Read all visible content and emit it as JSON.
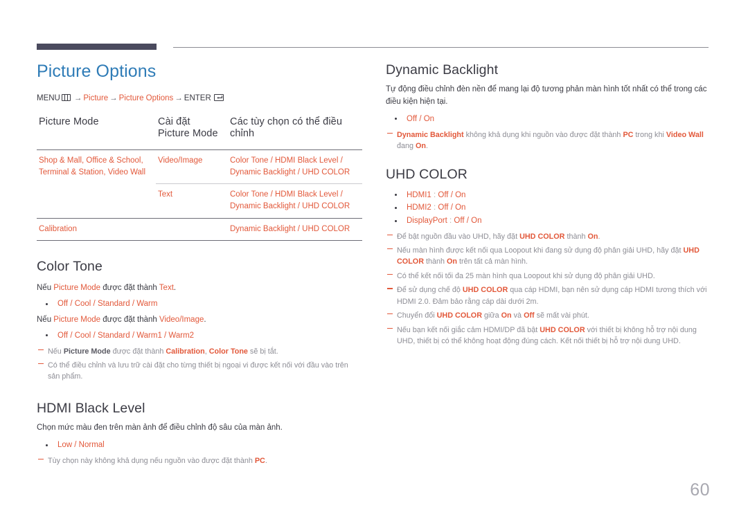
{
  "page": {
    "number": "60",
    "accent_blue": "#2f7cb7",
    "accent_orange": "#e2583a",
    "note_gray": "#8d8d95"
  },
  "left": {
    "title": "Picture Options",
    "breadcrumb": {
      "menu_label": "MENU",
      "menu_icon": "menu-grid-icon",
      "arrow": "→",
      "item1": "Picture",
      "item2": "Picture Options",
      "enter_label": "ENTER",
      "enter_icon": "enter-key-icon"
    },
    "table": {
      "headers": [
        "Picture Mode",
        "Cài đặt Picture Mode",
        "Các tùy chọn có thể điều chỉnh"
      ],
      "rows": [
        {
          "mode": "Shop & Mall, Office & School, Terminal & Station, Video Wall",
          "setting": "Video/Image",
          "options": "Color Tone / HDMI Black Level / Dynamic Backlight / UHD COLOR"
        },
        {
          "mode": "",
          "setting": "Text",
          "options": "Color Tone / HDMI Black Level / Dynamic Backlight / UHD COLOR"
        },
        {
          "mode": "Calibration",
          "setting": "",
          "options": "Dynamic Backlight / UHD COLOR"
        }
      ]
    },
    "color_tone": {
      "heading": "Color Tone",
      "line1_pre": "Nếu ",
      "line1_term": "Picture Mode",
      "line1_mid": " được đặt thành ",
      "line1_val": "Text",
      "line1_end": ".",
      "options1": "Off / Cool / Standard / Warm",
      "line2_pre": "Nếu ",
      "line2_term": "Picture Mode",
      "line2_mid": " được đặt thành ",
      "line2_val": "Video/Image",
      "line2_end": ".",
      "options2": "Off / Cool / Standard / Warm1 / Warm2",
      "note1_a": "Nếu ",
      "note1_b": "Picture Mode",
      "note1_c": " được đặt thành ",
      "note1_d": "Calibration",
      "note1_e": ", ",
      "note1_f": "Color Tone",
      "note1_g": " sẽ bị tắt.",
      "note2": "Có thể điều chỉnh và lưu trữ cài đặt cho từng thiết bị ngoại vi được kết nối với đầu vào trên sản phẩm."
    },
    "hdmi_black_level": {
      "heading": "HDMI Black Level",
      "description": "Chọn mức màu đen trên màn ảnh để điều chỉnh độ sâu của màn ảnh.",
      "options": "Low / Normal",
      "note_a": "Tùy chọn này không khả dụng nếu nguồn vào được đặt thành ",
      "note_b": "PC",
      "note_c": "."
    }
  },
  "right": {
    "dynamic_backlight": {
      "heading": "Dynamic Backlight",
      "description": "Tự động điều chỉnh đèn nền để mang lại độ tương phản màn hình tốt nhất có thể trong các điều kiện hiện tại.",
      "options": "Off / On",
      "note_a": "Dynamic Backlight",
      "note_b": " không khả dụng khi nguồn vào được đặt thành ",
      "note_c": "PC",
      "note_d": " trong khi ",
      "note_e": "Video Wall",
      "note_f": " đang ",
      "note_g": "On",
      "note_h": "."
    },
    "uhd_color": {
      "heading": "UHD COLOR",
      "options": [
        {
          "label": "HDMI1",
          "sep": " : ",
          "values": "Off / On"
        },
        {
          "label": "HDMI2",
          "sep": " : ",
          "values": "Off / On"
        },
        {
          "label": "DisplayPort",
          "sep": " : ",
          "values": "Off / On"
        }
      ],
      "notes": [
        {
          "parts": [
            {
              "t": "Để bật nguồn đầu vào UHD, hãy đặt ",
              "s": "gray"
            },
            {
              "t": "UHD COLOR",
              "s": "ob"
            },
            {
              "t": " thành ",
              "s": "gray"
            },
            {
              "t": "On",
              "s": "ob"
            },
            {
              "t": ".",
              "s": "gray"
            }
          ]
        },
        {
          "parts": [
            {
              "t": "Nếu màn hình được kết nối qua Loopout khi đang sử dụng độ phân giải UHD, hãy đặt ",
              "s": "gray"
            },
            {
              "t": "UHD COLOR",
              "s": "ob"
            },
            {
              "t": " thành ",
              "s": "gray"
            },
            {
              "t": "On",
              "s": "ob"
            },
            {
              "t": " trên tất cả màn hình.",
              "s": "gray"
            }
          ]
        },
        {
          "parts": [
            {
              "t": "Có thể kết nối tối đa 25 màn hình qua Loopout khi sử dụng độ phân giải UHD.",
              "s": "gray"
            }
          ]
        },
        {
          "parts": [
            {
              "t": "Để sử dụng chế độ ",
              "s": "gray"
            },
            {
              "t": "UHD COLOR",
              "s": "ob"
            },
            {
              "t": " qua cáp HDMI, bạn nên sử dụng cáp HDMI tương thích với HDMI 2.0. Đảm bảo rằng cáp dài dưới 2m.",
              "s": "gray"
            }
          ]
        },
        {
          "parts": [
            {
              "t": "Chuyển đổi ",
              "s": "gray"
            },
            {
              "t": "UHD COLOR",
              "s": "ob"
            },
            {
              "t": " giữa ",
              "s": "gray"
            },
            {
              "t": "On",
              "s": "ob"
            },
            {
              "t": " và ",
              "s": "gray"
            },
            {
              "t": "Off",
              "s": "ob"
            },
            {
              "t": " sẽ mất vài phút.",
              "s": "gray"
            }
          ]
        },
        {
          "parts": [
            {
              "t": "Nếu bạn kết nối giắc cảm HDMI/DP đã bật ",
              "s": "gray"
            },
            {
              "t": "UHD COLOR",
              "s": "ob"
            },
            {
              "t": " với thiết bị không hỗ trợ nội dung UHD, thiết bị có thể không hoạt động đúng cách. Kết nối thiết bị hỗ trợ nội dung UHD.",
              "s": "gray"
            }
          ]
        }
      ]
    }
  }
}
